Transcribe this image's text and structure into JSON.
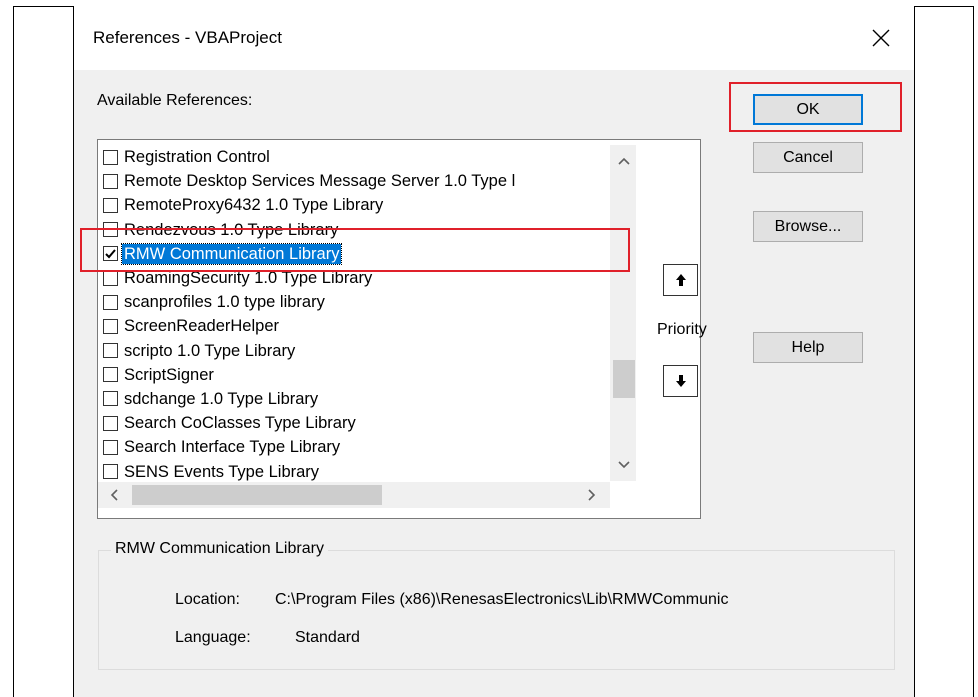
{
  "dialog": {
    "title": "References - VBAProject",
    "available_label": "Available References:",
    "priority_label": "Priority"
  },
  "buttons": {
    "ok": "OK",
    "cancel": "Cancel",
    "browse": "Browse...",
    "help": "Help"
  },
  "references": [
    {
      "name": "Registration Control",
      "checked": false,
      "selected": false
    },
    {
      "name": "Remote Desktop Services Message Server 1.0 Type l",
      "checked": false,
      "selected": false
    },
    {
      "name": "RemoteProxy6432 1.0 Type Library",
      "checked": false,
      "selected": false
    },
    {
      "name": "Rendezvous 1.0 Type Library",
      "checked": false,
      "selected": false
    },
    {
      "name": "RMW Communication Library",
      "checked": true,
      "selected": true
    },
    {
      "name": "RoamingSecurity 1.0 Type Library",
      "checked": false,
      "selected": false
    },
    {
      "name": "scanprofiles 1.0 type library",
      "checked": false,
      "selected": false
    },
    {
      "name": "ScreenReaderHelper",
      "checked": false,
      "selected": false
    },
    {
      "name": "scripto 1.0 Type Library",
      "checked": false,
      "selected": false
    },
    {
      "name": "ScriptSigner",
      "checked": false,
      "selected": false
    },
    {
      "name": "sdchange 1.0 Type Library",
      "checked": false,
      "selected": false
    },
    {
      "name": "Search CoClasses Type Library",
      "checked": false,
      "selected": false
    },
    {
      "name": "Search Interface Type Library",
      "checked": false,
      "selected": false
    },
    {
      "name": "SENS Events Type Library",
      "checked": false,
      "selected": false
    }
  ],
  "details": {
    "group_title": "RMW Communication Library",
    "location_label": "Location:",
    "location_value": "C:\\Program Files (x86)\\RenesasElectronics\\Lib\\RMWCommunic",
    "language_label": "Language:",
    "language_value": "Standard"
  },
  "colors": {
    "highlight": "#0078d7",
    "annotation": "#e0202a"
  }
}
